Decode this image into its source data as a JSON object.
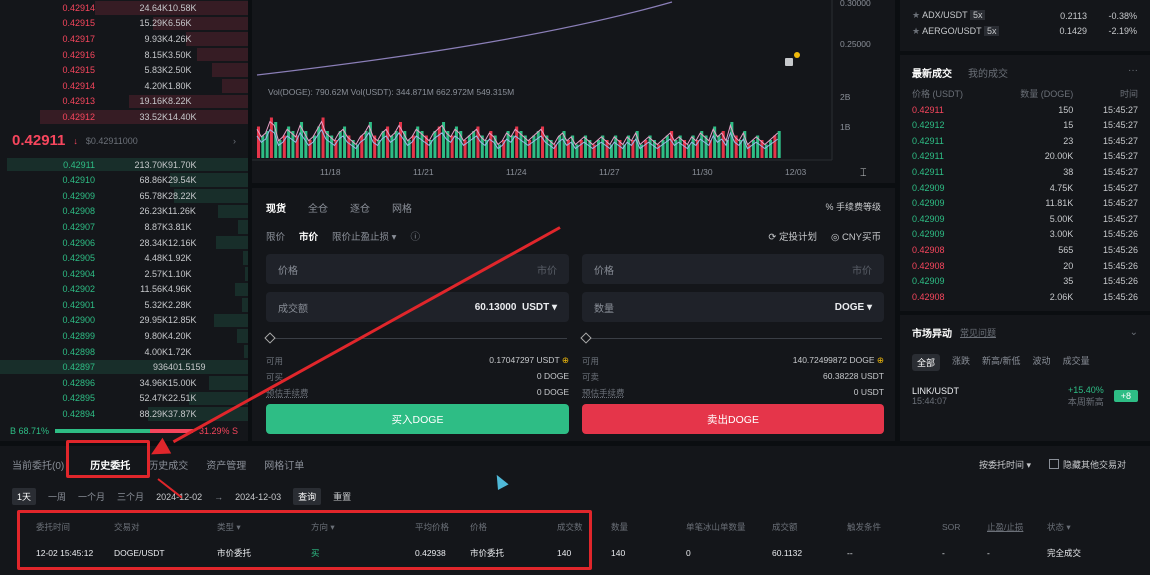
{
  "orderbook": {
    "asks": [
      {
        "p": "0.42914",
        "a": "24.64K",
        "t": "10.58K"
      },
      {
        "p": "0.42915",
        "a": "15.29K",
        "t": "6.56K"
      },
      {
        "p": "0.42917",
        "a": "9.93K",
        "t": "4.26K"
      },
      {
        "p": "0.42916",
        "a": "8.15K",
        "t": "3.50K"
      },
      {
        "p": "0.42915",
        "a": "5.83K",
        "t": "2.50K"
      },
      {
        "p": "0.42914",
        "a": "4.20K",
        "t": "1.80K"
      },
      {
        "p": "0.42913",
        "a": "19.16K",
        "t": "8.22K"
      },
      {
        "p": "0.42912",
        "a": "33.52K",
        "t": "14.40K"
      }
    ],
    "last_price": "0.42911",
    "last_arrow": "↓",
    "last_usd": "$0.42911000",
    "bids": [
      {
        "p": "0.42911",
        "a": "213.70K",
        "t": "91.70K"
      },
      {
        "p": "0.42910",
        "a": "68.86K",
        "t": "29.54K"
      },
      {
        "p": "0.42909",
        "a": "65.78K",
        "t": "28.22K"
      },
      {
        "p": "0.42908",
        "a": "26.23K",
        "t": "11.26K"
      },
      {
        "p": "0.42907",
        "a": "8.87K",
        "t": "3.81K"
      },
      {
        "p": "0.42906",
        "a": "28.34K",
        "t": "12.16K"
      },
      {
        "p": "0.42905",
        "a": "4.48K",
        "t": "1.92K"
      },
      {
        "p": "0.42904",
        "a": "2.57K",
        "t": "1.10K"
      },
      {
        "p": "0.42902",
        "a": "11.56K",
        "t": "4.96K"
      },
      {
        "p": "0.42901",
        "a": "5.32K",
        "t": "2.28K"
      },
      {
        "p": "0.42900",
        "a": "29.95K",
        "t": "12.85K"
      },
      {
        "p": "0.42899",
        "a": "9.80K",
        "t": "4.20K"
      },
      {
        "p": "0.42898",
        "a": "4.00K",
        "t": "1.72K"
      },
      {
        "p": "0.42897",
        "a": "936",
        "t": "401.5159"
      },
      {
        "p": "0.42896",
        "a": "34.96K",
        "t": "15.00K"
      },
      {
        "p": "0.42895",
        "a": "52.47K",
        "t": "22.51K"
      },
      {
        "p": "0.42894",
        "a": "88.29K",
        "t": "37.87K"
      }
    ],
    "buy_ratio": "B 68.71%",
    "sell_ratio": "31.29% S"
  },
  "chart": {
    "price_ticks": [
      "0.30000",
      "0.25000"
    ],
    "vol_label": "Vol(DOGE): 790.62M  Vol(USDT): 344.871M  662.972M  549.315M",
    "vol_ticks": [
      "2B",
      "1B"
    ],
    "dates": [
      "11/18",
      "11/21",
      "11/24",
      "11/27",
      "11/30",
      "12/03"
    ],
    "volumes": [
      0.7,
      0.5,
      0.6,
      0.9,
      0.8,
      0.4,
      0.5,
      0.7,
      0.6,
      0.5,
      0.8,
      0.6,
      0.4,
      0.5,
      0.7,
      0.9,
      0.6,
      0.5,
      0.4,
      0.6,
      0.7,
      0.5,
      0.4,
      0.3,
      0.5,
      0.6,
      0.8,
      0.5,
      0.4,
      0.6,
      0.7,
      0.5,
      0.6,
      0.8,
      0.6,
      0.4,
      0.5,
      0.7,
      0.6,
      0.5,
      0.4,
      0.6,
      0.7,
      0.8,
      0.6,
      0.5,
      0.7,
      0.6,
      0.4,
      0.5,
      0.6,
      0.7,
      0.5,
      0.4,
      0.6,
      0.5,
      0.3,
      0.4,
      0.6,
      0.5,
      0.7,
      0.6,
      0.5,
      0.4,
      0.5,
      0.6,
      0.7,
      0.5,
      0.4,
      0.3,
      0.5,
      0.6,
      0.4,
      0.5,
      0.3,
      0.4,
      0.5,
      0.4,
      0.3,
      0.4,
      0.5,
      0.4,
      0.3,
      0.5,
      0.4,
      0.3,
      0.5,
      0.4,
      0.6,
      0.3,
      0.4,
      0.5,
      0.4,
      0.3,
      0.4,
      0.5,
      0.6,
      0.4,
      0.5,
      0.4,
      0.3,
      0.5,
      0.4,
      0.6,
      0.5,
      0.4,
      0.7,
      0.5,
      0.6,
      0.4,
      0.8,
      0.5,
      0.4,
      0.6,
      0.3,
      0.4,
      0.5,
      0.4,
      0.3,
      0.4,
      0.5,
      0.6
    ]
  },
  "form": {
    "tabs": [
      "现货",
      "全仓",
      "逐仓",
      "网格"
    ],
    "fee_label": "手续费等级",
    "order_types": [
      "限价",
      "市价",
      "限价止盈止损 ▾"
    ],
    "right_links": [
      "定投计划",
      "CNY买币"
    ],
    "buy": {
      "price_label": "价格",
      "price_hint": "市价",
      "amount_label": "成交额",
      "amount_value": "60.13000",
      "amount_unit": "USDT ▾",
      "avail_label": "可用",
      "avail_value": "0.17047297 USDT",
      "can_buy_label": "可买",
      "can_buy_value": "0 DOGE",
      "fee_label": "预估手续费",
      "fee_value": "0 DOGE",
      "button": "买入DOGE"
    },
    "sell": {
      "price_label": "价格",
      "price_hint": "市价",
      "amount_label": "数量",
      "amount_unit": "DOGE ▾",
      "avail_label": "可用",
      "avail_value": "140.72499872 DOGE",
      "can_sell_label": "可卖",
      "can_sell_value": "60.38228 USDT",
      "fee_label": "预估手续费",
      "fee_value": "0 USDT",
      "button": "卖出DOGE"
    }
  },
  "right": {
    "top_pairs": [
      {
        "name": "ADX/USDT",
        "lev": "5x",
        "price": "0.2113",
        "chg": "-0.38%"
      },
      {
        "name": "AERGO/USDT",
        "lev": "5x",
        "price": "0.1429",
        "chg": "-2.19%"
      }
    ],
    "tabs": [
      "最新成交",
      "我的成交"
    ],
    "headers": [
      "价格 (USDT)",
      "数量 (DOGE)",
      "时间"
    ],
    "trades": [
      {
        "p": "0.42911",
        "q": "150",
        "t": "15:45:27",
        "c": "red"
      },
      {
        "p": "0.42912",
        "q": "15",
        "t": "15:45:27",
        "c": "green"
      },
      {
        "p": "0.42911",
        "q": "23",
        "t": "15:45:27",
        "c": "green"
      },
      {
        "p": "0.42911",
        "q": "20.00K",
        "t": "15:45:27",
        "c": "green"
      },
      {
        "p": "0.42911",
        "q": "38",
        "t": "15:45:27",
        "c": "green"
      },
      {
        "p": "0.42909",
        "q": "4.75K",
        "t": "15:45:27",
        "c": "green"
      },
      {
        "p": "0.42909",
        "q": "11.81K",
        "t": "15:45:27",
        "c": "green"
      },
      {
        "p": "0.42909",
        "q": "5.00K",
        "t": "15:45:27",
        "c": "green"
      },
      {
        "p": "0.42909",
        "q": "3.00K",
        "t": "15:45:26",
        "c": "green"
      },
      {
        "p": "0.42908",
        "q": "565",
        "t": "15:45:26",
        "c": "red"
      },
      {
        "p": "0.42908",
        "q": "20",
        "t": "15:45:26",
        "c": "red"
      },
      {
        "p": "0.42909",
        "q": "35",
        "t": "15:45:26",
        "c": "green"
      },
      {
        "p": "0.42908",
        "q": "2.06K",
        "t": "15:45:26",
        "c": "red"
      }
    ],
    "market_title": "市场异动",
    "market_link": "常见问题",
    "market_tabs": [
      "全部",
      "涨跌",
      "新高/新低",
      "波动",
      "成交量"
    ],
    "alert": {
      "pair": "LINK/USDT",
      "time": "15:44:07",
      "chg": "+15.40%",
      "desc": "本周新高",
      "badge": "+8"
    }
  },
  "bottom": {
    "tabs": [
      "当前委托(0)",
      "历史委托",
      "历史成交",
      "资产管理",
      "网格订单"
    ],
    "sort_label": "按委托时间 ▾",
    "hide_label": "隐藏其他交易对",
    "ranges": [
      "1天",
      "一周",
      "一个月",
      "三个月"
    ],
    "date_from": "2024-12-02",
    "date_to": "2024-12-03",
    "query": "查询",
    "reset": "重置",
    "headers": [
      "委托时间",
      "交易对",
      "类型 ▾",
      "方向 ▾",
      "平均价格",
      "价格",
      "成交数",
      "数量",
      "单笔冰山单数量",
      "成交额",
      "触发条件",
      "SOR",
      "止盈/止损",
      "状态 ▾"
    ],
    "row": [
      "12-02 15:45:12",
      "DOGE/USDT",
      "市价委托",
      "买",
      "0.42938",
      "市价委托",
      "140",
      "140",
      "0",
      "60.1132",
      "--",
      "-",
      "-",
      "完全成交"
    ]
  }
}
